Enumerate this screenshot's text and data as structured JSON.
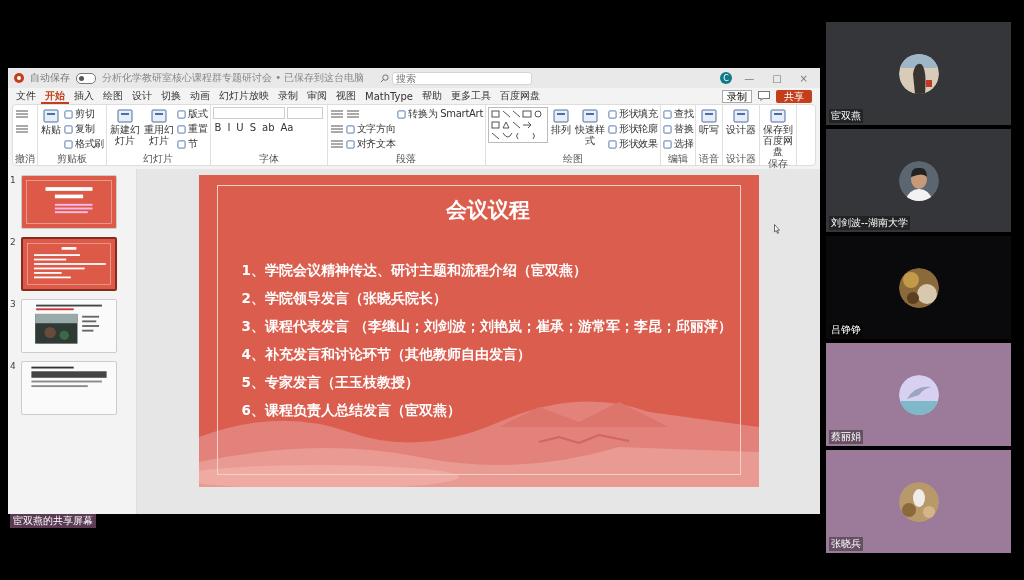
{
  "shared_screen": {
    "label": "宦双燕的共享屏幕"
  },
  "title_bar": {
    "autosave": {
      "label": "自动保存",
      "on": false
    },
    "document_title": "分析化学教研室核心课程群专题研讨会 • 已保存到这台电脑",
    "search": {
      "placeholder": "搜索"
    },
    "avatar": "C",
    "buttons": [
      "—",
      "□",
      "×"
    ]
  },
  "menu": [
    {
      "label": "文件",
      "selected": false
    },
    {
      "label": "开始",
      "selected": true
    },
    {
      "label": "插入",
      "selected": false
    },
    {
      "label": "绘图",
      "selected": false
    },
    {
      "label": "设计",
      "selected": false
    },
    {
      "label": "切换",
      "selected": false
    },
    {
      "label": "动画",
      "selected": false
    },
    {
      "label": "幻灯片放映",
      "selected": false
    },
    {
      "label": "录制",
      "selected": false
    },
    {
      "label": "审阅",
      "selected": false
    },
    {
      "label": "视图",
      "selected": false
    },
    {
      "label": "MathType",
      "selected": false
    },
    {
      "label": "帮助",
      "selected": false
    },
    {
      "label": "更多工具",
      "selected": false
    },
    {
      "label": "百度网盘",
      "selected": false
    }
  ],
  "menu_actions": {
    "record": "录制",
    "share": "共享"
  },
  "ribbon": [
    {
      "label": "撤消",
      "items": [
        {
          "kind": "icon"
        },
        {
          "kind": "icon"
        }
      ]
    },
    {
      "label": "剪贴板",
      "items": [
        {
          "kind": "large",
          "label": "粘贴"
        },
        {
          "kind": "small",
          "label": "剪切"
        },
        {
          "kind": "small",
          "label": "复制"
        },
        {
          "kind": "small",
          "label": "格式刷"
        }
      ]
    },
    {
      "label": "幻灯片",
      "items": [
        {
          "kind": "large",
          "label": "新建幻灯片"
        },
        {
          "kind": "large",
          "label": "重用幻灯片"
        },
        {
          "kind": "small",
          "label": "版式"
        },
        {
          "kind": "small",
          "label": "重置"
        },
        {
          "kind": "small",
          "label": "节"
        }
      ]
    },
    {
      "label": "字体",
      "items": [
        {
          "kind": "field"
        },
        {
          "kind": "field"
        },
        {
          "kind": "letter",
          "label": "B"
        },
        {
          "kind": "letter",
          "label": "I"
        },
        {
          "kind": "letter",
          "label": "U"
        },
        {
          "kind": "letter",
          "label": "S"
        },
        {
          "kind": "letter",
          "label": "ab"
        },
        {
          "kind": "letter",
          "label": "Aa"
        }
      ]
    },
    {
      "label": "段落",
      "items": [
        {
          "kind": "icon"
        },
        {
          "kind": "icon"
        },
        {
          "kind": "icon"
        },
        {
          "kind": "icon"
        },
        {
          "kind": "small",
          "label": "文字方向"
        },
        {
          "kind": "small",
          "label": "对齐文本"
        },
        {
          "kind": "small",
          "label": "转换为 SmartArt"
        }
      ]
    },
    {
      "label": "绘图",
      "items": [
        {
          "kind": "shapes"
        },
        {
          "kind": "large",
          "label": "排列"
        },
        {
          "kind": "large",
          "label": "快速样式"
        },
        {
          "kind": "small",
          "label": "形状填充"
        },
        {
          "kind": "small",
          "label": "形状轮廓"
        },
        {
          "kind": "small",
          "label": "形状效果"
        }
      ]
    },
    {
      "label": "编辑",
      "items": [
        {
          "kind": "small",
          "label": "查找"
        },
        {
          "kind": "small",
          "label": "替换"
        },
        {
          "kind": "small",
          "label": "选择"
        }
      ]
    },
    {
      "label": "语音",
      "items": [
        {
          "kind": "large",
          "label": "听写"
        }
      ]
    },
    {
      "label": "设计器",
      "items": [
        {
          "kind": "large",
          "label": "设计器"
        }
      ]
    },
    {
      "label": "保存",
      "items": [
        {
          "kind": "large",
          "label": "保存到百度网盘"
        }
      ]
    }
  ],
  "thumbnails": [
    {
      "number": "1",
      "kind": "title",
      "selected": false
    },
    {
      "number": "2",
      "kind": "list",
      "selected": true
    },
    {
      "number": "3",
      "selected": false
    },
    {
      "number": "4",
      "kind": "text",
      "selected": false
    }
  ],
  "slide": {
    "title": "会议议程",
    "items": [
      "1、学院会议精神传达、研讨主题和流程介绍（宦双燕）",
      "2、学院领导发言（张晓兵院长）",
      "3、课程代表发言 （李继山；刘剑波；刘艳岚；崔承；游常军；李昆；邱丽萍）",
      "4、补充发言和讨论环节（其他教师自由发言）",
      "5、专家发言（王玉枝教授）",
      "6、课程负责人总结发言（宦双燕）"
    ]
  },
  "participants": [
    {
      "name": "宦双燕",
      "kind": "grey"
    },
    {
      "name": "刘剑波--湖南大学",
      "kind": "grey"
    },
    {
      "name": "吕铮铮",
      "kind": "dark"
    },
    {
      "name": "蔡丽娟",
      "kind": "purple"
    },
    {
      "name": "张晓兵",
      "kind": "purple"
    }
  ]
}
